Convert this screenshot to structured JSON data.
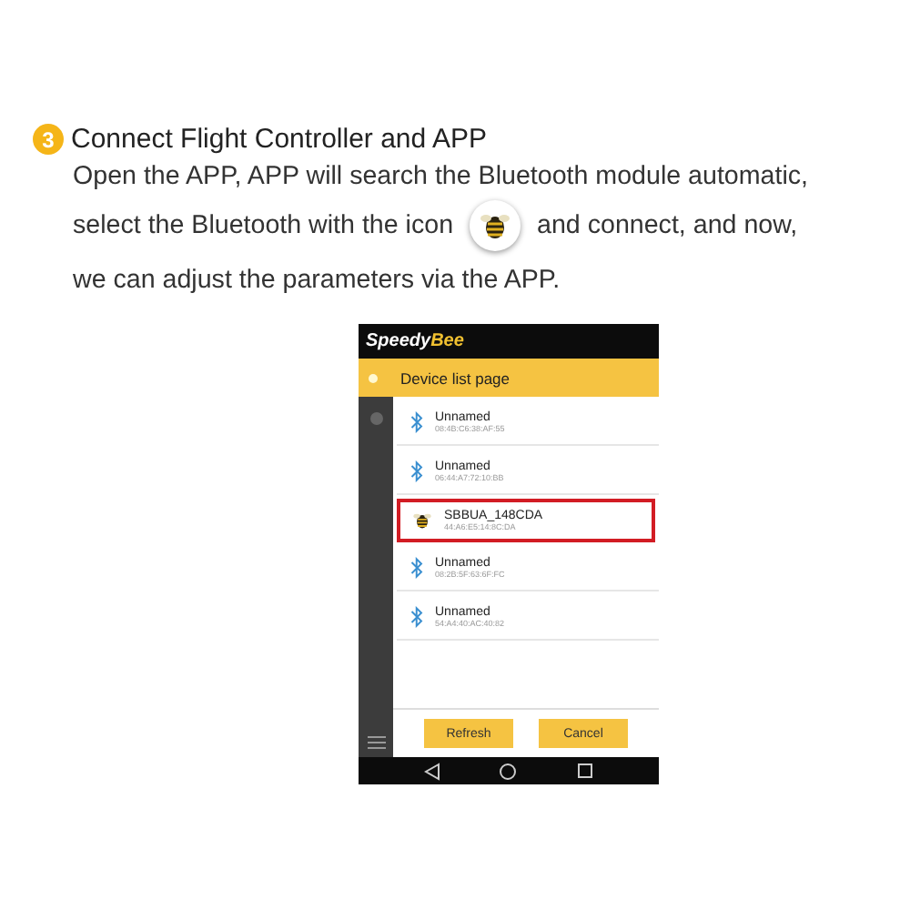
{
  "step": {
    "number": "3",
    "title": "Connect Flight Controller and APP"
  },
  "paragraph_lines": [
    {
      "parts": [
        "Open the APP, APP will search the Bluetooth module automatic,"
      ]
    },
    {
      "parts": [
        "select the Bluetooth with the icon",
        "and connect, and now,"
      ]
    },
    {
      "parts": [
        "we can adjust the parameters via the APP."
      ]
    }
  ],
  "phone": {
    "brand": {
      "first": "Speedy",
      "second": "Bee"
    },
    "page_title": "Device list page",
    "devices": [
      {
        "kind": "bluetooth",
        "name": "Unnamed",
        "address": "08:4B:C6:38:AF:55",
        "selected": false
      },
      {
        "kind": "bluetooth",
        "name": "Unnamed",
        "address": "06:44:A7:72:10:BB",
        "selected": false
      },
      {
        "kind": "bee",
        "name": "SBBUA_148CDA",
        "address": "44:A6:E5:14:8C:DA",
        "selected": true
      },
      {
        "kind": "bluetooth",
        "name": "Unnamed",
        "address": "08:2B:5F:63:6F:FC",
        "selected": false
      },
      {
        "kind": "bluetooth",
        "name": "Unnamed",
        "address": "54:A4:40:AC:40:82",
        "selected": false
      }
    ],
    "buttons": [
      "Refresh",
      "Cancel"
    ]
  }
}
